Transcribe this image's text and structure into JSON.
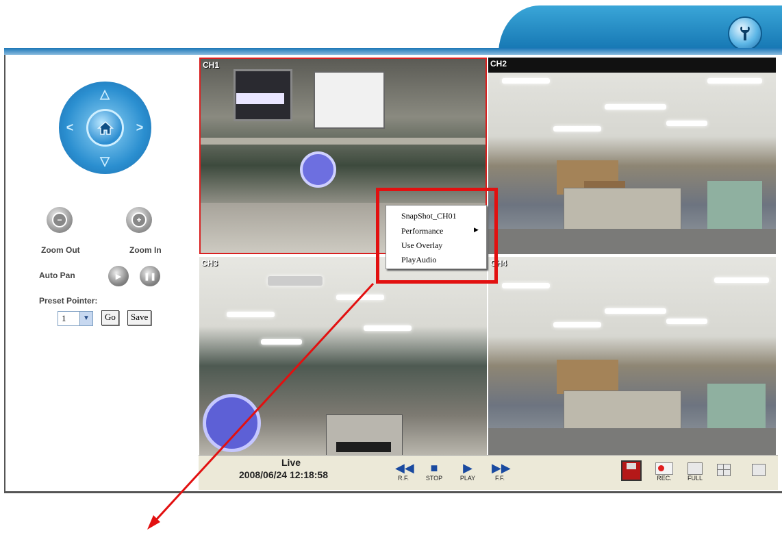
{
  "header": {
    "settings_icon": "wrench-icon"
  },
  "ptz": {
    "up": "△",
    "down": "▽",
    "left": "<",
    "right": ">",
    "home_icon": "home-icon",
    "zoom_out_label": "Zoom Out",
    "zoom_in_label": "Zoom In",
    "auto_pan_label": "Auto Pan",
    "preset_label": "Preset Pointer:",
    "preset_value": "1",
    "go_label": "Go",
    "save_label": "Save"
  },
  "channels": [
    "CH1",
    "CH2",
    "CH3",
    "CH4"
  ],
  "context_menu": {
    "items": [
      "SnapShot_CH01",
      "Performance",
      "Use Overlay",
      "PlayAudio"
    ]
  },
  "status": {
    "mode": "Live",
    "datetime": "2008/06/24 12:18:58"
  },
  "controls": {
    "rf": "R.F.",
    "stop": "STOP",
    "play": "PLAY",
    "ff": "F.F.",
    "rec": "REC.",
    "full": "FULL"
  },
  "colors": {
    "accent": "#1b76b6",
    "highlight": "#e21010",
    "selected_border": "#d92020"
  }
}
